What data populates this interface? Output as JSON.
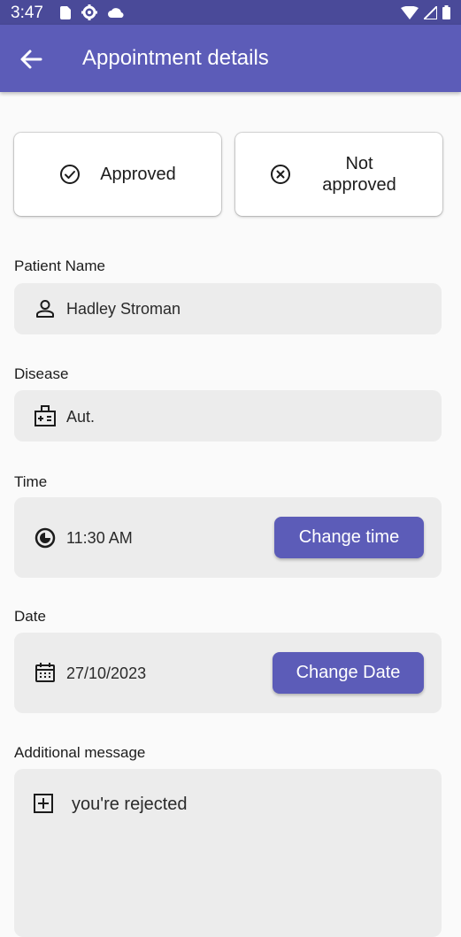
{
  "status_bar": {
    "time": "3:47"
  },
  "app_bar": {
    "title": "Appointment details"
  },
  "status_options": [
    {
      "label": "Approved",
      "icon": "check-circle-icon"
    },
    {
      "label": "Not approved",
      "icon": "cross-circle-icon"
    }
  ],
  "patient": {
    "label": "Patient Name",
    "value": "Hadley Stroman",
    "icon": "person-icon"
  },
  "disease": {
    "label": "Disease",
    "value": "Aut.",
    "icon": "medical-kit-icon"
  },
  "time": {
    "label": "Time",
    "value": "11:30 AM",
    "icon": "clock-icon",
    "button_label": "Change time"
  },
  "date": {
    "label": "Date",
    "value": "27/10/2023",
    "icon": "calendar-icon",
    "button_label": "Change Date"
  },
  "message": {
    "label": "Additional message",
    "value": "you're rejected",
    "icon": "add-box-icon"
  },
  "colors": {
    "primary": "#5c5cb8",
    "status_bar": "#4a4a99",
    "field_background": "#ececec"
  }
}
